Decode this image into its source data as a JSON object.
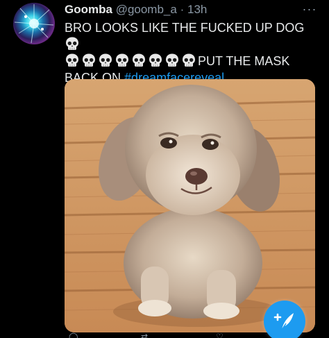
{
  "tweet": {
    "display_name": "Goomba",
    "handle": "@goomb_a",
    "separator": "·",
    "timestamp": "13h",
    "text_line1": "BRO LOOKS LIKE THE FUCKED UP DOG",
    "text_line2_suffix": "PUT THE MASK",
    "text_line3": "BACK ON",
    "hashtag": "#dreamfacereveal",
    "skull_count_line2": 8,
    "more_glyph": "···"
  },
  "icons": {
    "more": "more-horizontal-icon",
    "skull": "skull-emoji-icon",
    "compose": "compose-tweet-icon"
  },
  "colors": {
    "background": "#000000",
    "text": "#e7e9ea",
    "secondary": "#8b98a5",
    "accent": "#1d9bf0"
  }
}
